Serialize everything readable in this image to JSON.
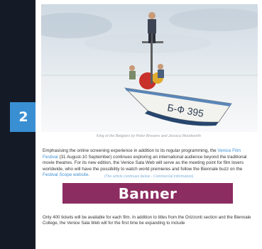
{
  "step": {
    "number": "2"
  },
  "article": {
    "photo": {
      "boat_number": "Б-Ф 395"
    },
    "caption": "King of the Belgians by Peter Brosens and Jessica Woodworth",
    "intro": {
      "part1": "Emphasising the online screening experience in addition to its regular programming, the ",
      "link1": "Venice Film Festival",
      "part2": " (31 August-10 September) continues exploring an international audience beyond the traditional movie theatres. For its new edition, the Venice Sala Web will serve as the meeting point for film lovers worldwide, who will have the possibility to watch world premieres and follow the Biennale buzz on the ",
      "link2": "Festival Scope website",
      "part3": "."
    },
    "notice": "(The article continues below - Commercial information)",
    "banner": "Banner",
    "outro": "Only 400 tickets will be available for each film. In addition to titles from the Orizzonti section and the Biennale College, the Venice Sala Web will for the first time be expanding to include"
  }
}
